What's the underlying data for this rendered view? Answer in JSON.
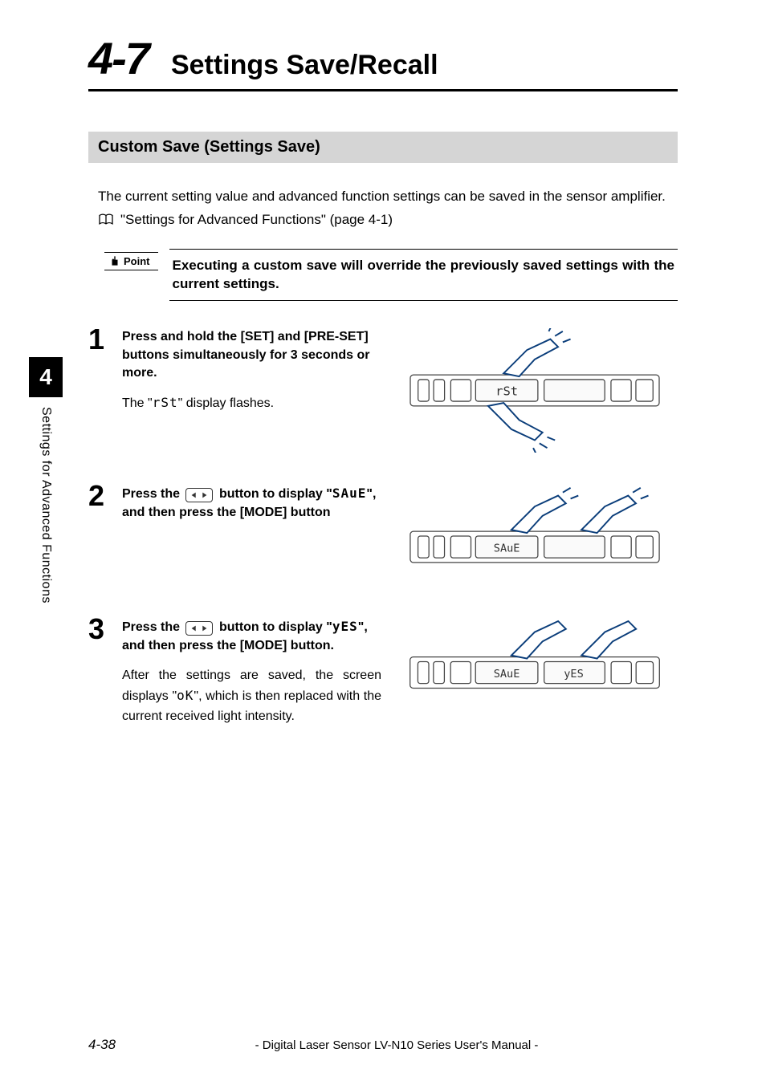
{
  "section_number": "4-7",
  "section_title": "Settings Save/Recall",
  "subheading": "Custom Save (Settings Save)",
  "intro_paragraph": "The current setting value and advanced function settings can be saved in the sensor amplifier.",
  "xref_text": "\"Settings for Advanced Functions\" (page 4-1)",
  "point_label": "Point",
  "point_body": "Executing a custom save will override the previously saved settings with the current settings.",
  "steps": [
    {
      "title": "Press and hold the [SET] and [PRE-SET] buttons simultaneously for 3 seconds or more.",
      "body_before": "The \"",
      "body_seg": "rSt",
      "body_after": "\" display flashes."
    },
    {
      "title_before": "Press the ",
      "title_mid": " button to display \"",
      "title_seg": "SAuE",
      "title_after": "\", and then press the [MODE] button"
    },
    {
      "title_before": "Press the ",
      "title_mid": " button to display \"",
      "title_seg": "yES",
      "title_after": "\", and then press the [MODE] button.",
      "body_before": "After the settings are saved, the screen displays \"",
      "body_seg": "oK",
      "body_after": "\", which is then replaced with the current received light intensity."
    }
  ],
  "side_tab_number": "4",
  "side_tab_text": "Settings for Advanced Functions",
  "footer_page_number": "4-38",
  "footer_manual": "- Digital Laser Sensor LV-N10 Series User's Manual -",
  "chart_data": null
}
